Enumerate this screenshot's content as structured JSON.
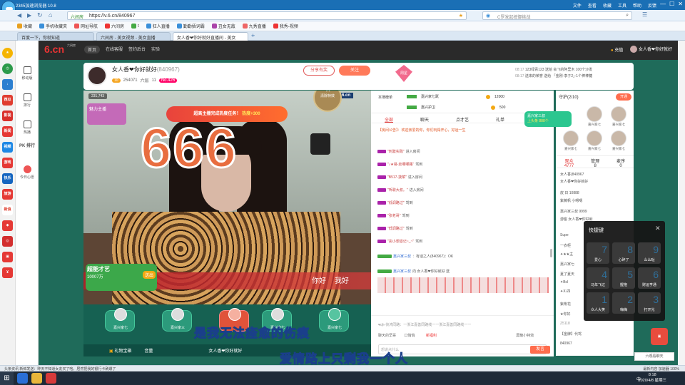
{
  "browser": {
    "title": "2345加速浏览器 10.8",
    "menu": [
      "文件",
      "查看",
      "收藏",
      "工具",
      "帮助",
      "反馈"
    ],
    "url": "https://v.6.cn/840967",
    "url_badge": "六间房",
    "search_placeholder": "C罗发起抵御挑战",
    "bookmarks": [
      "收藏",
      "手机收藏夹",
      "网址导航",
      "六间房",
      "t",
      "狂人直播",
      "勤勤捂词霸",
      "丑女无敌",
      "九秀直播",
      "我秀-视频"
    ],
    "tabs": [
      "百度一下，你就知道",
      "六间房 - 美女视频 - 美女直播",
      "女人香❤你好就好直播间 - 美女",
      "+"
    ],
    "status_left": "头条资讯  新鲜发送：昨天不知道女友买了啥，居然把我的银行卡刷爆了",
    "status_right": "最新内容  加速器  100%",
    "clock_time": "8:18",
    "clock_date": "2020/4/8 星期三",
    "ime": "中"
  },
  "sidebar": {
    "items": [
      {
        "label": "移动版"
      },
      {
        "label": "排行"
      },
      {
        "label": "热播"
      },
      {
        "label": "PK 排行"
      },
      {
        "label": "今日心愿"
      }
    ],
    "browser_icons": [
      "西瓜",
      "影视",
      "新闻",
      "视频",
      "游戏",
      "快乐",
      "旅游",
      "新浪"
    ]
  },
  "site": {
    "logo": "6.cn",
    "logo_sub": "六间房",
    "nav": [
      "首页",
      "在线客服",
      "签约后台",
      "实验"
    ],
    "right": [
      "充值",
      "女人香❤你好就好"
    ]
  },
  "anchor": {
    "name": "女人香❤你好就好",
    "id": "(840967)",
    "fans": "254071",
    "stat_label": "六层",
    "level": "11",
    "badge": "No.426",
    "share_label": "分享有奖",
    "follow_label": "关注",
    "rank_label": "周星",
    "ticker": [
      {
        "time": "08:17",
        "text": "123绿青123 送给 会飞的阿里木 100个沙发"
      },
      {
        "time": "08:17",
        "text": "送来的荣誉 送给 「金刚·李子2」·1个棒棒糖"
      }
    ]
  },
  "video": {
    "view_count": "231,743",
    "watermark": "6.cn",
    "task_text": "超高主播完成热度任务！",
    "task_highlight": "热度+300",
    "big_text": "666",
    "fx_label": "清除特效",
    "mbadge": "魅力主播",
    "danmu": [
      "你好",
      "我好"
    ],
    "super_label": "超能才艺",
    "super_sub": "10007万",
    "super_btn": "送出"
  },
  "seats": [
    {
      "name": "嘉兴家七"
    },
    {
      "name": "嘉兴家三"
    },
    {
      "name": "嘉兴家七"
    },
    {
      "name": "嘉兴家七"
    }
  ],
  "lyrics": [
    "是我无法痊愈的伤痕",
    "爱情路上只剩我一个人"
  ],
  "giftbar": {
    "label": "礼物宝箱",
    "sub": "音量",
    "anchor": "女人香❤你好就好"
  },
  "rank": {
    "label": "本场榜单",
    "rows": [
      {
        "name": "嘉兴家七跃",
        "value": "12000"
      },
      {
        "name": "嘉兴护卫",
        "value": "500"
      }
    ]
  },
  "chat": {
    "tabs": [
      "全部",
      "聊天",
      "点才艺",
      "礼单",
      "活动"
    ],
    "notice": "【房间公告】：欢迎亲爱的你，你们玩得开心，好运一生",
    "messages": [
      {
        "name": "\"刺激实践\"",
        "text": "进入房间"
      },
      {
        "name": "\"♪★易-走哪哪路\"",
        "text": "驾到"
      },
      {
        "name": "\"B517-菠菜\"",
        "text": "进入房间"
      },
      {
        "name": "\"听歌大叔。\"",
        "text": "进入房间"
      },
      {
        "name": "\"低调路过\"",
        "text": "驾到"
      },
      {
        "name": "\"张老哥\"",
        "text": "驾到"
      },
      {
        "name": "\"低调路过\"",
        "text": "驾到"
      },
      {
        "name": "\"完小想退记~_~\"",
        "text": "驾到"
      },
      {
        "name": "嘉兴家三叔",
        "text": "：有话之人(840967)：OK"
      },
      {
        "name": "嘉兴家三叔",
        "text": "向 女人香❤你好就好 送"
      }
    ],
    "input_hint": "♥qh-侦鸿同路：一浙江嘉善同路线一一浙江嘉善同路线一一",
    "chat_label": "聊天的早哥",
    "checkbox_label": "口悄悄",
    "gift_label": "新福利",
    "screen_label": "屏蔽小特效",
    "send_placeholder": "想说点什么",
    "send_label": "发言"
  },
  "guard": {
    "label": "守护(2/10)",
    "open_label": "开通",
    "members": [
      "嘉兴家七",
      "嘉兴家七",
      "嘉兴家七",
      "嘉兴家七",
      "嘉兴家七",
      "嘉兴家七"
    ]
  },
  "card": {
    "title": "嘉兴家三叔",
    "sub": "上头条 888个"
  },
  "audience": {
    "tabs": [
      {
        "label": "观众",
        "count": "4777"
      },
      {
        "label": "管理",
        "count": "8"
      },
      {
        "label": "麦序",
        "count": "0"
      }
    ],
    "list": [
      "女人香(840967",
      "女人香❤你好就好",
      "皮 日 10888",
      "紫薇帆  小嗯嗯",
      "嘉兴家三叔  9999",
      "游客 女人香❤你好就",
      "Supe",
      "一衣柜",
      "✦★★主",
      "嘉兴家七",
      "夏了夏天",
      "✦Bcl",
      "✦Ⅹ·四",
      "紫荆花",
      "★你好",
      "Z5118",
      "【金牌】代驾",
      "840967"
    ]
  },
  "shortcut": {
    "title": "快捷键",
    "keys": [
      {
        "num": "7",
        "label": "爱心"
      },
      {
        "num": "8",
        "label": "心碎了"
      },
      {
        "num": "9",
        "label": "么么哒"
      },
      {
        "num": "4",
        "label": "马年飞过"
      },
      {
        "num": "5",
        "label": "握抱"
      },
      {
        "num": "6",
        "label": "财运亨通"
      },
      {
        "num": "1",
        "label": "众人大笑"
      },
      {
        "num": "2",
        "label": "嗨嗨"
      },
      {
        "num": "3",
        "label": "打开光"
      }
    ]
  },
  "float_btn": "六观看聊天"
}
